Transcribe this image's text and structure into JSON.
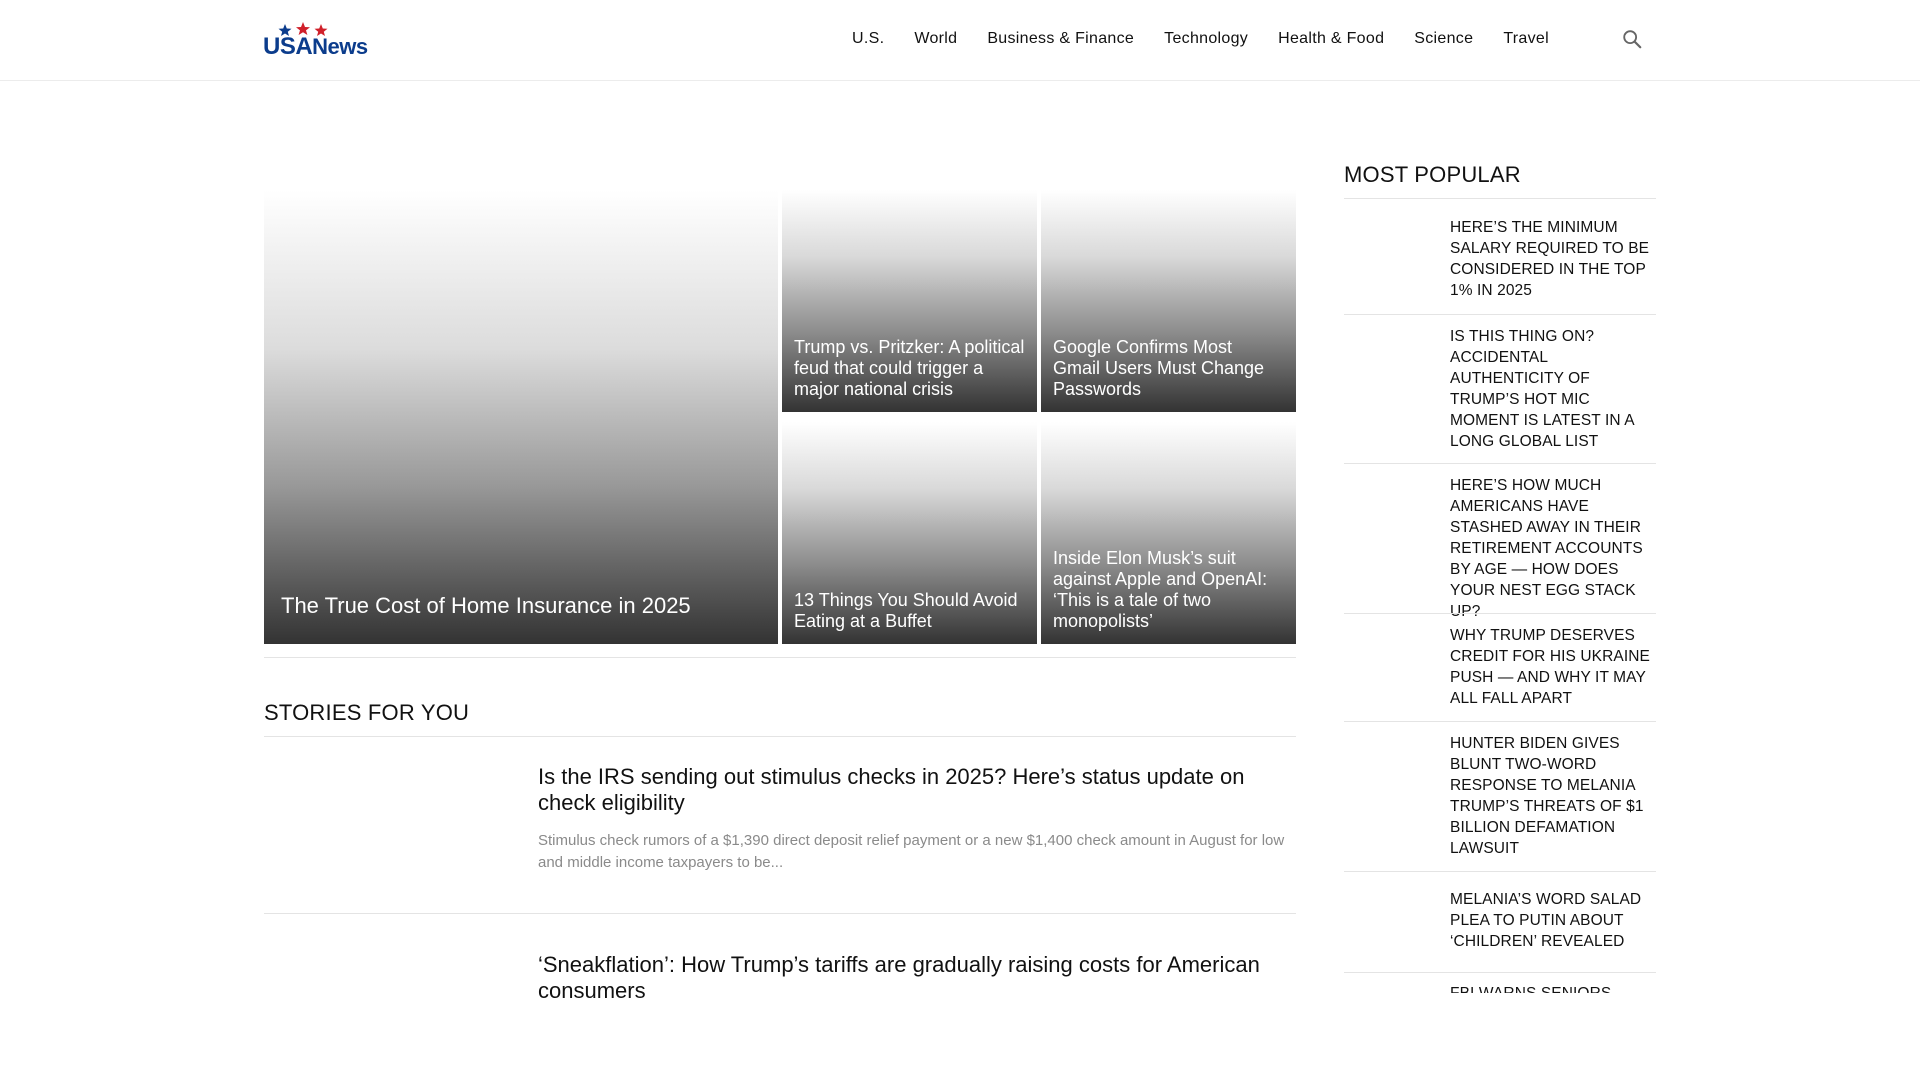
{
  "header": {
    "logo": {
      "usa": "USA",
      "news": "News"
    },
    "nav": [
      "U.S.",
      "World",
      "Business & Finance",
      "Technology",
      "Health & Food",
      "Science",
      "Travel"
    ],
    "search_icon": "search-icon"
  },
  "hero": {
    "main": "The True Cost of Home Insurance in 2025",
    "tiles": [
      "Trump vs. Pritzker: A political feud that could trigger a major national crisis",
      "Google Confirms Most Gmail Users Must Change Passwords",
      "13 Things You Should Avoid Eating at a Buffet",
      "Inside Elon Musk’s suit against Apple and OpenAI: ‘This is a tale of two monopolists’"
    ]
  },
  "stories": {
    "heading": "STORIES FOR YOU",
    "items": [
      {
        "title": "Is the IRS sending out stimulus checks in 2025? Here’s status update on check eligibility",
        "excerpt": "Stimulus check rumors of a $1,390 direct deposit relief payment or a new $1,400 check amount in August for low and middle income taxpayers to be..."
      },
      {
        "title": "‘Sneakflation’: How Trump’s tariffs are gradually raising costs for American consumers",
        "excerpt": ""
      }
    ]
  },
  "sidebar": {
    "heading": "MOST POPULAR",
    "items": [
      "Here’s the minimum salary required to be considered in the top 1% in 2025",
      "Is this thing on? Accidental authenticity of Trump’s hot mic moment is latest in a long global list",
      "Here’s how much Americans have stashed away in their retirement accounts by age — how does your nest egg stack up?",
      "Why Trump deserves credit for his Ukraine push — and why it may all fall apart",
      "Hunter Biden gives blunt two-word response to Melania Trump’s threats of $1 billion defamation lawsuit",
      "Melania’s word salad plea to Putin about ‘children’ revealed",
      "FBI warns seniors"
    ]
  },
  "colors": {
    "brand_blue": "#0b3c8c",
    "brand_red": "#d0202a"
  }
}
